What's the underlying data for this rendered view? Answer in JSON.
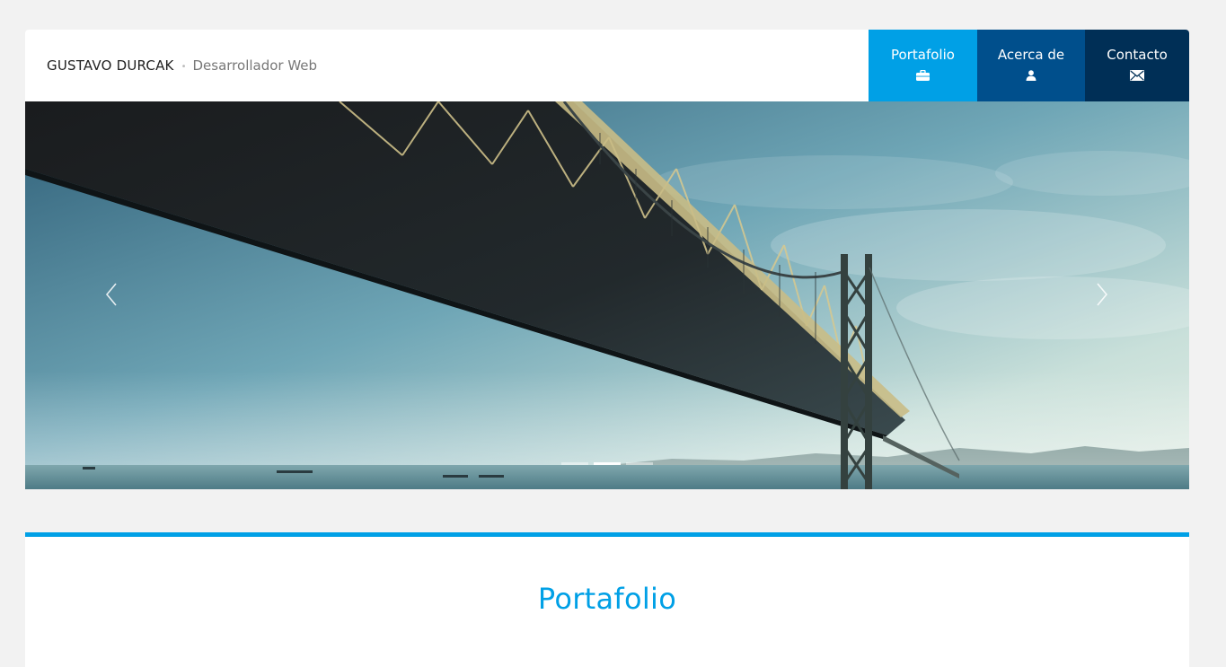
{
  "brand": {
    "name": "GUSTAVO DURCAK",
    "separator": "•",
    "role": "Desarrollador Web"
  },
  "nav": {
    "items": [
      {
        "label": "Portafolio",
        "icon": "briefcase-icon",
        "active": true,
        "color": "#00a0e6"
      },
      {
        "label": "Acerca de",
        "icon": "user-icon",
        "active": false,
        "color": "#004f8c"
      },
      {
        "label": "Contacto",
        "icon": "envelope-icon",
        "active": false,
        "color": "#002f56"
      }
    ]
  },
  "carousel": {
    "slide_count": 3,
    "active_index": 1,
    "prev_icon": "chevron-left-icon",
    "next_icon": "chevron-right-icon"
  },
  "portfolio": {
    "title": "Portafolio",
    "accent": "#00a0e6"
  }
}
